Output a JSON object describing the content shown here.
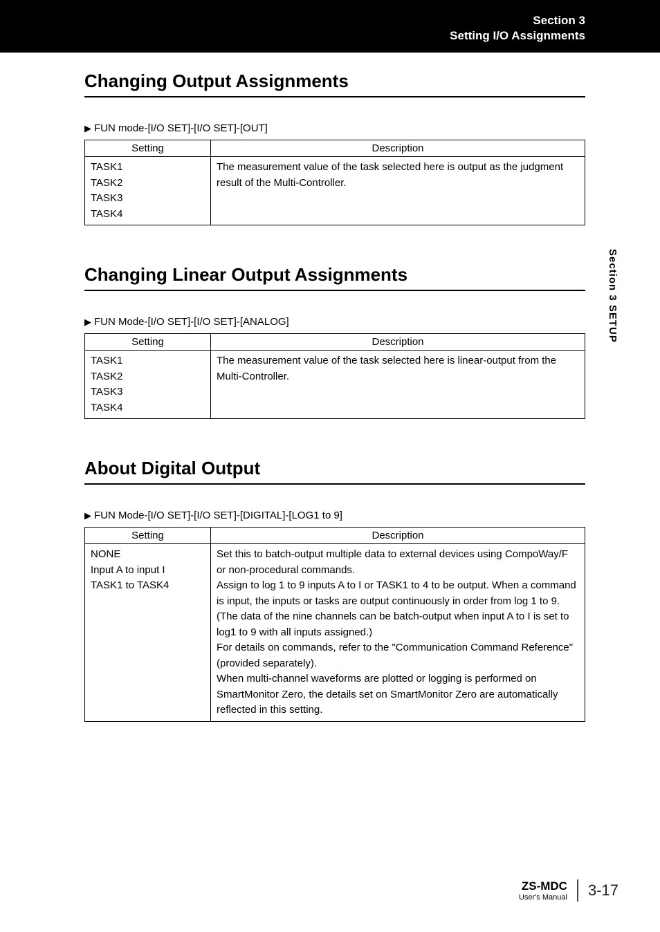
{
  "header": {
    "line1": "Section 3",
    "line2": "Setting I/O Assignments"
  },
  "section1": {
    "title": "Changing Output Assignments",
    "nav": "FUN mode-[I/O SET]-[I/O SET]-[OUT]",
    "th1": "Setting",
    "th2": "Description",
    "setting": "TASK1\nTASK2\nTASK3\nTASK4",
    "desc": "The measurement value of the task selected here is output as the judgment result of the Multi-Controller."
  },
  "section2": {
    "title": "Changing Linear Output Assignments",
    "nav": "FUN Mode-[I/O SET]-[I/O SET]-[ANALOG]",
    "th1": "Setting",
    "th2": "Description",
    "setting": "TASK1\nTASK2\nTASK3\nTASK4",
    "desc": "The measurement value of the task selected here is linear-output from the Multi-Controller."
  },
  "section3": {
    "title": "About Digital Output",
    "nav": "FUN Mode-[I/O SET]-[I/O SET]-[DIGITAL]-[LOG1 to 9]",
    "th1": "Setting",
    "th2": "Description",
    "setting": "NONE\nInput A to input I\nTASK1 to TASK4",
    "desc": "Set this to batch-output multiple data to external devices using CompoWay/F or non-procedural commands.\nAssign to log 1 to 9 inputs A to I or TASK1 to 4 to be output. When a command is input, the inputs or tasks are output continuously in order from log 1 to 9.\n(The data of the nine channels can be batch-output when input A to I is set to log1 to 9 with all inputs  assigned.)\nFor details on commands, refer to the \"Communication Command Reference\" (provided separately).\nWhen multi-channel waveforms are plotted or logging is performed on SmartMonitor Zero, the details set on SmartMonitor Zero are automatically reflected in this setting."
  },
  "sideTab": "Section 3   SETUP",
  "footer": {
    "docName": "ZS-MDC",
    "docSub": "User's Manual",
    "page": "3-17"
  }
}
